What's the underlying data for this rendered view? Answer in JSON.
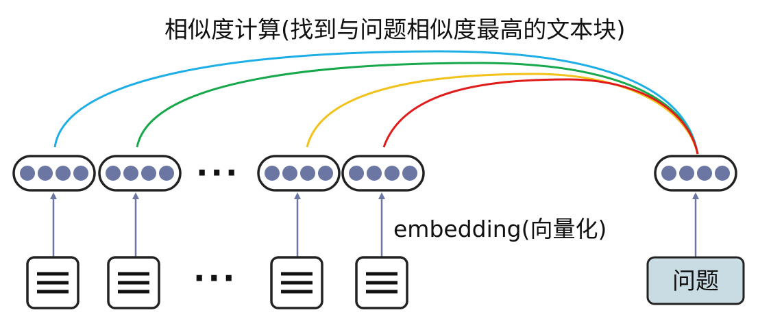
{
  "diagram": {
    "title": "相似度计算(找到与问题相似度最高的文本块)",
    "embedding_label": "embedding(向量化)",
    "question_label": "问题",
    "ellipsis_top": "···",
    "ellipsis_bottom": "···"
  },
  "colors": {
    "arc_1": "#1eaee6",
    "arc_2": "#16a84a",
    "arc_3": "#f2c21b",
    "arc_4": "#e01b1b",
    "dot": "#6b76a3",
    "arrow": "#6b76a3",
    "question_box_fill": "#c9dbe3",
    "outline": "#222222"
  }
}
